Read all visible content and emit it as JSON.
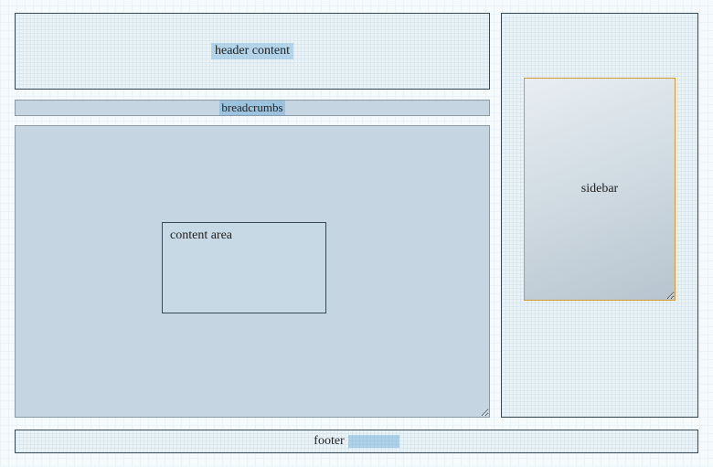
{
  "layout": {
    "header": {
      "label": "header content"
    },
    "breadcrumbs": {
      "label": "breadcrumbs"
    },
    "main": {
      "content": {
        "label": "content area"
      }
    },
    "right": {
      "sidebar": {
        "label": "sidebar"
      }
    },
    "footer": {
      "label": "footer"
    }
  }
}
